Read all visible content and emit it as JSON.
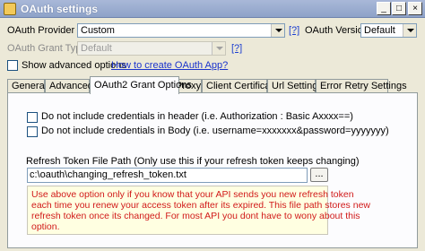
{
  "window": {
    "title": "OAuth settings",
    "minimize": "_",
    "maximize": "□",
    "close": "×"
  },
  "provider": {
    "label": "OAuth Provider",
    "value": "Custom",
    "help": "[?]"
  },
  "version": {
    "label": "OAuth Version",
    "value": "Default"
  },
  "grant_type": {
    "label": "OAuth Grant Type",
    "value": "Default",
    "help": "[?]"
  },
  "advanced": {
    "label": "Show advanced options",
    "checked": false,
    "link": "How to create OAuth App?"
  },
  "tabs": [
    {
      "label": "General",
      "active": false
    },
    {
      "label": "Advanced",
      "active": false
    },
    {
      "label": "OAuth2 Grant Options",
      "active": true
    },
    {
      "label": "Proxy",
      "active": false
    },
    {
      "label": "Client Certificate",
      "active": false
    },
    {
      "label": "Url Settings",
      "active": false
    },
    {
      "label": "Error Retry Settings",
      "active": false
    }
  ],
  "options": {
    "no_cred_header": "Do not include credentials in header (i.e. Authorization : Basic Axxxx==)",
    "no_cred_body": "Do not include credentials in Body (i.e. username=xxxxxxx&password=yyyyyyy)"
  },
  "refresh": {
    "label": "Refresh Token File Path (Only use this if your refresh token keeps changing)",
    "value": "c:\\oauth\\changing_refresh_token.txt",
    "browse": "..."
  },
  "info": {
    "lines": [
      "Use above option only if you know that your API sends you new refresh token",
      "each time you renew your access token after its expired. This file path stores new",
      "refresh token once its changed. For most API you dont have to wony about this",
      "option."
    ]
  }
}
